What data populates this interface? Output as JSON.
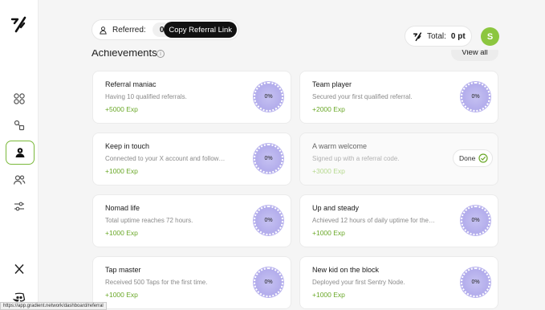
{
  "header": {
    "referred_label": "Referred:",
    "referred_count": "0",
    "copy_link_label": "Copy Referral Link",
    "total_label": "Total:",
    "total_value": "0 pt",
    "avatar_initial": "S"
  },
  "section": {
    "title": "Achievements",
    "info_icon": "i",
    "view_all_label": "View all"
  },
  "sidebar": {
    "items": [
      {
        "name": "dashboard",
        "icon": "grid-icon"
      },
      {
        "name": "nodes",
        "icon": "nodes-icon"
      },
      {
        "name": "profile",
        "icon": "user-icon",
        "active": true
      },
      {
        "name": "referrals",
        "icon": "users-icon"
      },
      {
        "name": "settings",
        "icon": "sliders-icon"
      }
    ],
    "bottom_icons": [
      "x-icon",
      "discord-icon"
    ]
  },
  "cards": [
    {
      "title": "Referral maniac",
      "desc": "Having 10 qualified referrals.",
      "exp": "+5000 Exp",
      "progress": "0%"
    },
    {
      "title": "Team player",
      "desc": "Secured your first qualified referral.",
      "exp": "+2000 Exp",
      "progress": "0%"
    },
    {
      "title": "Keep in touch",
      "desc": "Connected to your X account and follow…",
      "exp": "+1000 Exp",
      "progress": "0%"
    },
    {
      "title": "A warm welcome",
      "desc": "Signed up with a referral code.",
      "exp": "+3000 Exp",
      "done_label": "Done"
    },
    {
      "title": "Nomad life",
      "desc": "Total uptime reaches 72 hours.",
      "exp": "+1000 Exp",
      "progress": "0%"
    },
    {
      "title": "Up and steady",
      "desc": "Achieved 12 hours of daily uptime for the…",
      "exp": "+1000 Exp",
      "progress": "0%"
    },
    {
      "title": "Tap master",
      "desc": "Received 500 Taps for the first time.",
      "exp": "+1000 Exp",
      "progress": "0%"
    },
    {
      "title": "New kid on the block",
      "desc": "Deployed your first Sentry Node.",
      "exp": "+1000 Exp",
      "progress": "0%"
    }
  ],
  "status_bar": {
    "url": "https://app.gradient.network/dashboard/referral"
  },
  "colors": {
    "accent_green": "#8cc63f",
    "exp_green": "#6aa828",
    "ring_purple": "#b4aeec"
  }
}
